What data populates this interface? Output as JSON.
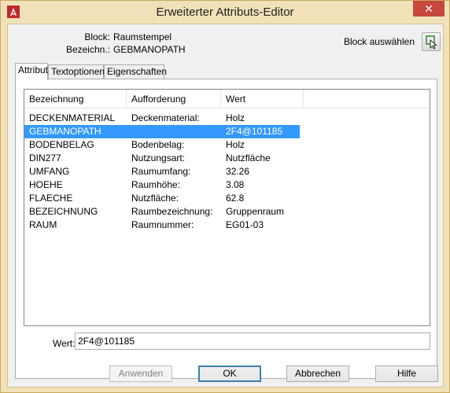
{
  "window": {
    "title": "Erweiterter Attributs-Editor",
    "close_label": "✕"
  },
  "info": {
    "block_label": "Block:",
    "block_value": "Raumstempel",
    "name_label": "Bezeichn.:",
    "name_value": "GEBMANOPATH",
    "block_select_label": "Block auswählen"
  },
  "tabs": [
    {
      "label": "Attribut",
      "active": true
    },
    {
      "label": "Textoptionen",
      "active": false
    },
    {
      "label": "Eigenschaften",
      "active": false
    }
  ],
  "table": {
    "columns": [
      "Bezeichnung",
      "Aufforderung",
      "Wert"
    ],
    "rows": [
      {
        "tag": "DECKENMATERIAL",
        "prompt": "Deckenmaterial:",
        "value": "Holz",
        "selected": false
      },
      {
        "tag": "GEBMANOPATH",
        "prompt": "",
        "value": "2F4@101185",
        "selected": true
      },
      {
        "tag": "BODENBELAG",
        "prompt": "Bodenbelag:",
        "value": "Holz",
        "selected": false
      },
      {
        "tag": "DIN277",
        "prompt": "Nutzungsart:",
        "value": "Nutzfläche",
        "selected": false
      },
      {
        "tag": "UMFANG",
        "prompt": "Raumumfang:",
        "value": "32.26",
        "selected": false
      },
      {
        "tag": "HOEHE",
        "prompt": "Raumhöhe:",
        "value": "3.08",
        "selected": false
      },
      {
        "tag": "FLAECHE",
        "prompt": "Nutzfläche:",
        "value": "62.8",
        "selected": false
      },
      {
        "tag": "BEZEICHNUNG",
        "prompt": "Raumbezeichnung:",
        "value": "Gruppenraum",
        "selected": false
      },
      {
        "tag": "RAUM",
        "prompt": "Raumnummer:",
        "value": "EG01-03",
        "selected": false
      }
    ]
  },
  "value_field": {
    "label": "Wert:",
    "value": "2F4@101185"
  },
  "buttons": {
    "apply": "Anwenden",
    "ok": "OK",
    "cancel": "Abbrechen",
    "help": "Hilfe"
  },
  "colors": {
    "selection": "#3399ff",
    "titlebar": "#f0e1b9",
    "close": "#c7483f"
  },
  "icons": {
    "app": "autocad-a-icon",
    "block_select": "pick-cursor-icon"
  }
}
